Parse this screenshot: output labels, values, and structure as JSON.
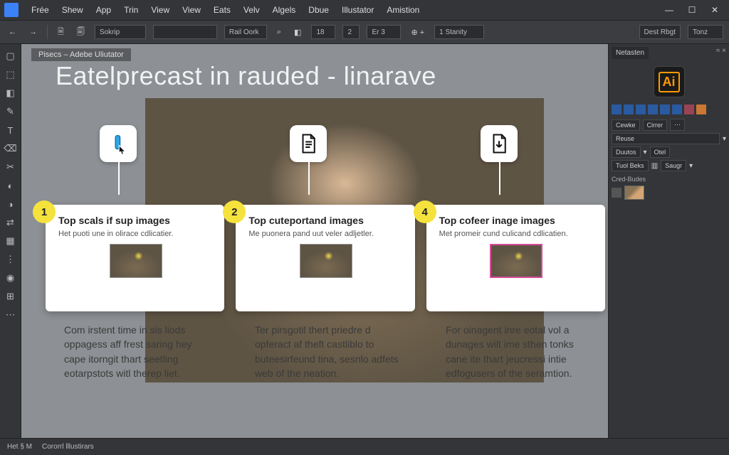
{
  "menus": [
    "Frée",
    "Shew",
    "App",
    "Trin",
    "View",
    "View",
    "Eats",
    "Velv",
    "Algels",
    "Dbue",
    "Illustator",
    "Amistion"
  ],
  "win": {
    "min": "—",
    "max": "☐",
    "close": "✕"
  },
  "topbar": {
    "back": "←",
    "fwd": "→",
    "preset": "Sokrip",
    "style": "Rail Oork",
    "search": "⌕",
    "v1": "18",
    "v2": "2",
    "v3": "Er 3",
    "plus": "⊕ +",
    "v4": "1 Stanity",
    "r1": "Dest Rbgt",
    "r2": "Tonz"
  },
  "tools": [
    "▢",
    "⬚",
    "◧",
    "✎",
    "T",
    "⌫",
    "✂",
    "◐",
    "◑",
    "⇄",
    "▦",
    "⋮",
    "◉",
    "⊞",
    "⋯"
  ],
  "right": {
    "tab": "Netasten",
    "ai": "Ai",
    "rows": [
      [
        "Cewke",
        "Cirrer",
        "⋯"
      ],
      [
        "Reuse",
        "▾"
      ],
      [
        "Duutos",
        "▾",
        "Otel"
      ],
      [
        "Tuol Beks",
        "▥",
        "Saugr",
        "▾"
      ]
    ],
    "subhead": "Cred-Budes"
  },
  "doc_tab": "Pisecs – Adebe Uliutator",
  "title": "Eatelprecast in rauded - linarave",
  "cards": [
    {
      "n": "1",
      "h": "Top scals if sup images",
      "p": "Het puoti une in olirace cdlicatier."
    },
    {
      "n": "2",
      "h": "Top cuteportand images",
      "p": "Me puonera pand uut veler adljetler."
    },
    {
      "n": "4",
      "h": "Top cofeer inage images",
      "p": "Met promeir cund culicand cdlicatien."
    }
  ],
  "paras": [
    "Com irstent time in sis liods oppagess aff frest saring hey cape itorngit thart seetling eotarpstots witl therep liet.",
    "Ter pirsgotil thert priedre d opferact af theft castliblo to buteesirfeund tina, sesnlo adfets web of the neation.",
    "For oinagent inre eotal vol a dunages wilt ime sthen tonks cane ite thart jeucressi intie edfogusers of the seramtion."
  ],
  "status": [
    "Het § M",
    "Cororrl lllustirars"
  ]
}
